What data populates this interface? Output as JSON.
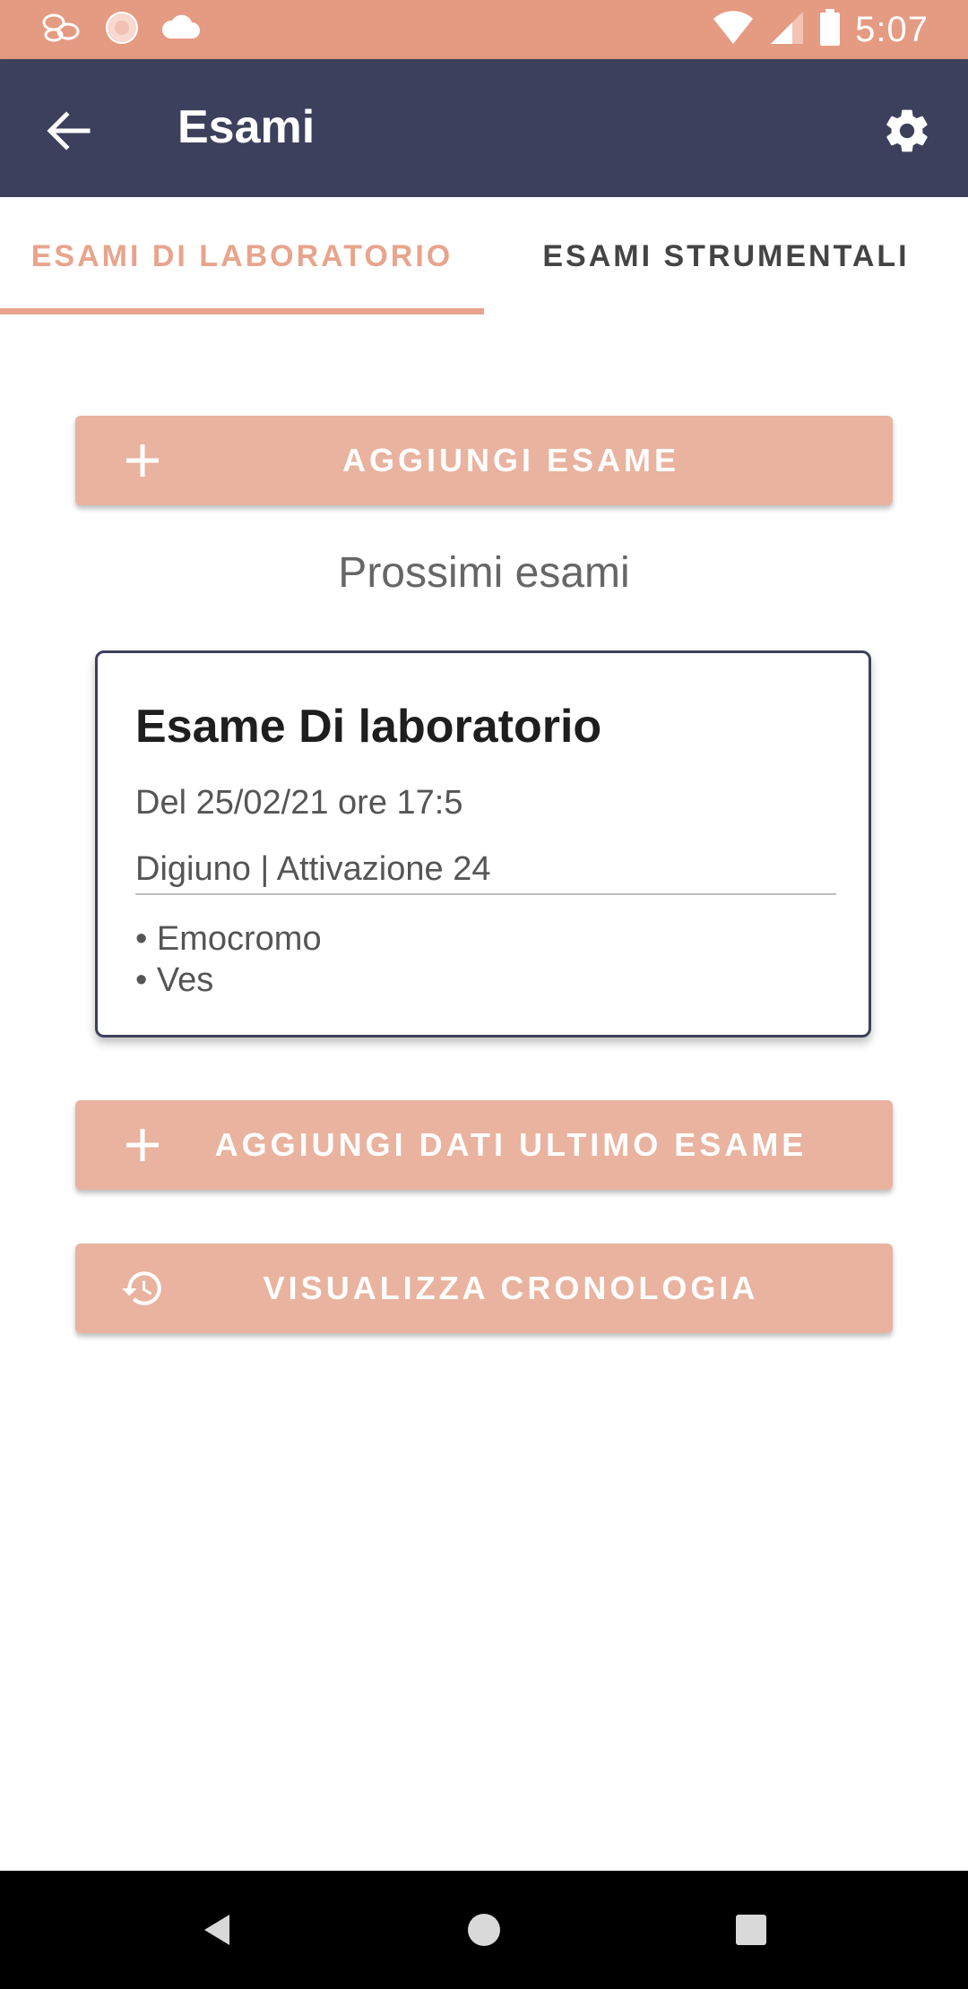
{
  "status_bar": {
    "time": "5:07",
    "icons": [
      "notification-icon-1",
      "notification-icon-2",
      "cloud-icon",
      "wifi-icon",
      "signal-icon",
      "battery-icon"
    ]
  },
  "app_bar": {
    "title": "Esami"
  },
  "tabs": [
    {
      "label": "ESAMI DI LABORATORIO",
      "selected": true
    },
    {
      "label": "ESAMI STRUMENTALI",
      "selected": false
    }
  ],
  "buttons": {
    "add_exam": "AGGIUNGI ESAME",
    "add_last_exam_data": "AGGIUNGI DATI ULTIMO ESAME",
    "view_history": "VISUALIZZA CRONOLOGIA"
  },
  "section": {
    "upcoming_title": "Prossimi esami"
  },
  "card": {
    "title": "Esame Di laboratorio",
    "date": "Del 25/02/21 ore 17:5",
    "meta": "Digiuno | Attivazione 24",
    "items": [
      "Emocromo",
      "Ves"
    ]
  },
  "colors": {
    "status_bar": "#e59a82",
    "app_bar": "#3d405c",
    "accent": "#e8a48c",
    "button": "#e9b39f"
  }
}
